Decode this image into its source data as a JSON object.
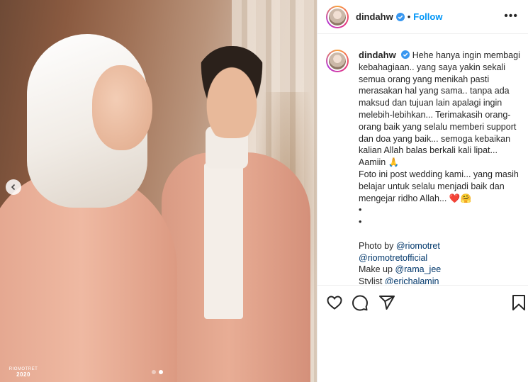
{
  "photo": {
    "watermark_brand": "RIOMOTRET",
    "watermark_year": "2020",
    "prev_icon": "chevron-left-icon",
    "carousel": {
      "count": 2,
      "active_index": 1
    }
  },
  "header": {
    "username": "dindahw",
    "separator": "•",
    "follow_label": "Follow",
    "more_label": "•••"
  },
  "caption": {
    "username": "dindahw",
    "text": "Hehe hanya ingin membagi kebahagiaan.. yang saya yakin sekali semua orang yang menikah pasti merasakan hal yang sama.. tanpa ada maksud dan tujuan lain apalagi ingin melebih-lebihkan... Terimakasih orang-orang baik yang selalu memberi support dan doa yang baik... semoga kebaikan kalian Allah balas berkali kali lipat... Aamiin",
    "text_emoji": "🙏",
    "text2": "Foto ini post wedding kami... yang masih belajar untuk selalu menjadi baik dan mengejar ridho Allah...",
    "text2_emoji": "❤️🤗",
    "bullet1": "•",
    "bullet2": "•",
    "credit1_label": "Photo by",
    "credit1_handle": "@riomotret",
    "credit2_handle": "@riomotretofficial",
    "credit3_label": "Make up",
    "credit3_handle": "@rama_jee",
    "credit4_label": "Stylist",
    "credit4_handle": "@erichalamin"
  },
  "colors": {
    "link": "#00376b",
    "follow": "#0095f6",
    "verified": "#3897f0"
  },
  "icons": [
    "heart-icon",
    "comment-icon",
    "share-icon",
    "bookmark-icon",
    "verified-badge-icon"
  ]
}
